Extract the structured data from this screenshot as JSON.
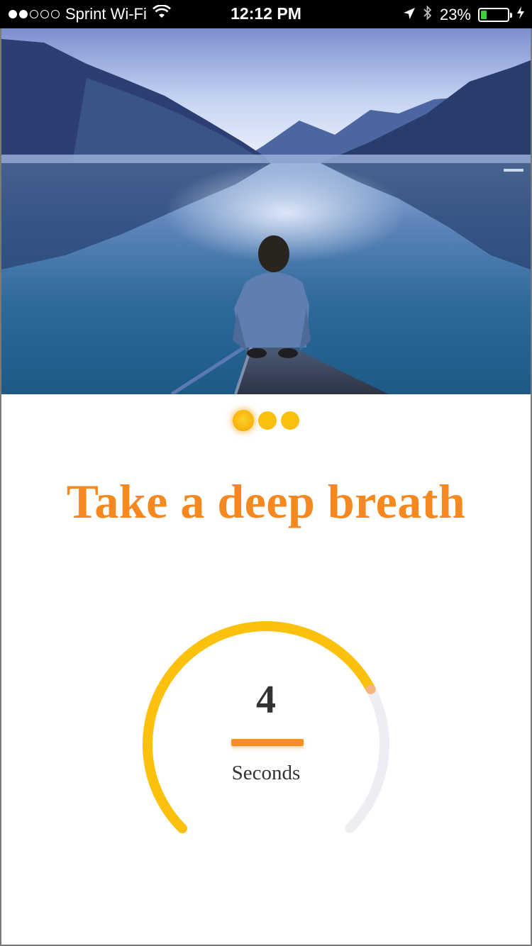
{
  "status_bar": {
    "carrier": "Sprint Wi-Fi",
    "signal_bars_filled": 2,
    "signal_bars_total": 5,
    "time": "12:12 PM",
    "battery_percent": "23%",
    "battery_level": 0.23,
    "icons": [
      "wifi-icon",
      "location-arrow-icon",
      "bluetooth-icon",
      "battery-icon",
      "charging-bolt-icon"
    ]
  },
  "hero": {
    "description_icon": "lake-photo"
  },
  "pager": {
    "count": 3,
    "active_index": 0
  },
  "title": "Take a deep breath",
  "timer": {
    "value": "4",
    "unit": "Seconds",
    "progress": 0.73
  },
  "colors": {
    "accent_orange": "#f5881f",
    "gauge_yellow": "#fcc10d",
    "gauge_track": "#eceef3",
    "dot_yellow": "#f9c10e"
  }
}
